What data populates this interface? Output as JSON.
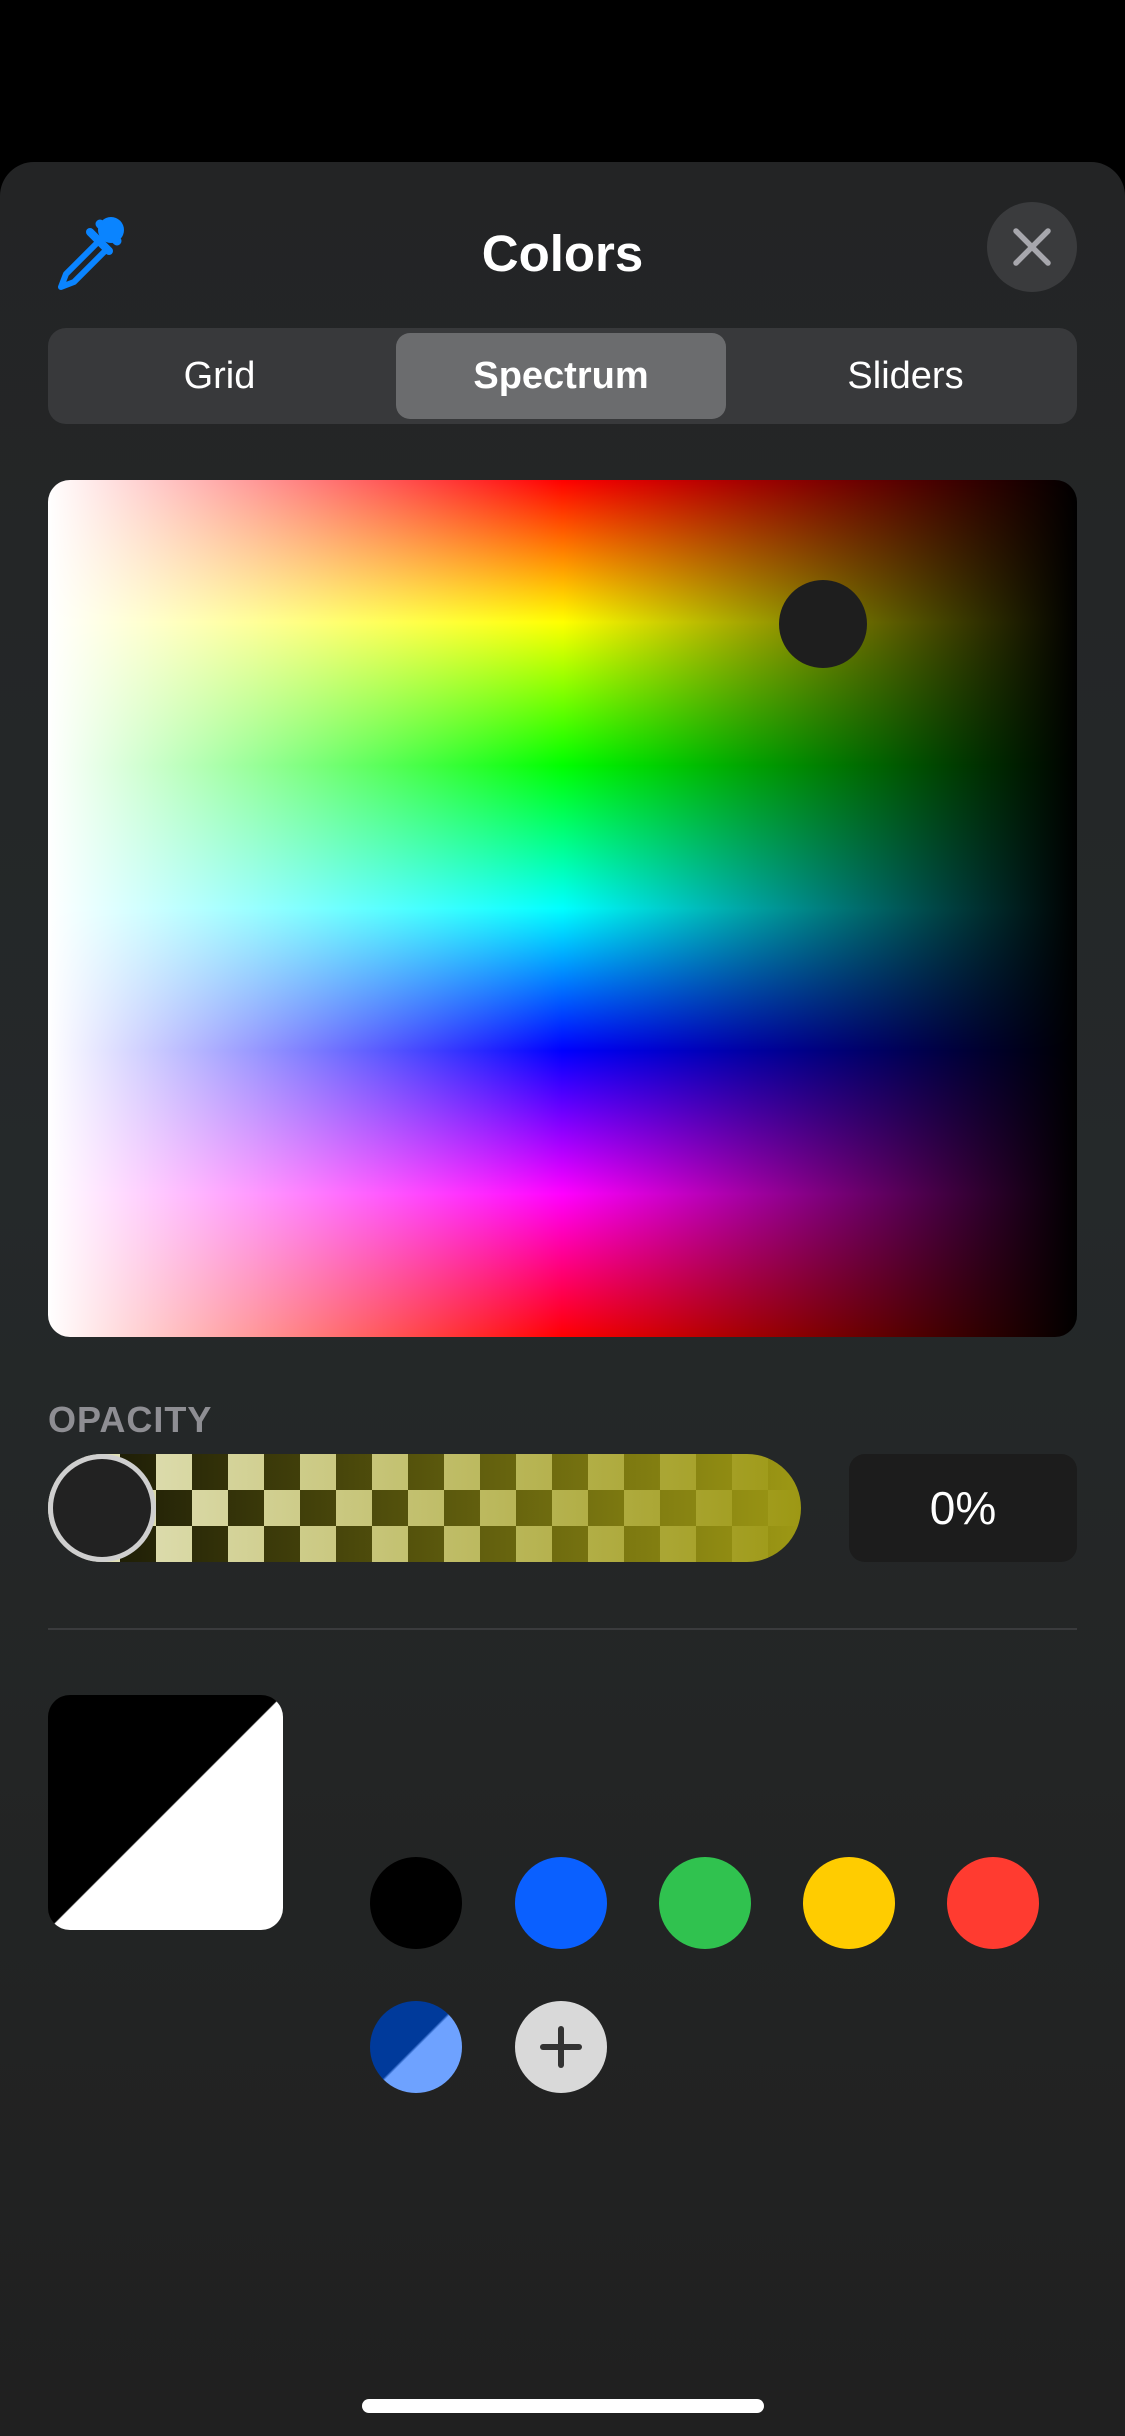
{
  "header": {
    "title": "Colors",
    "eyedropper_icon": "eyedropper-icon",
    "close_icon": "close-icon"
  },
  "tabs": [
    {
      "label": "Grid",
      "selected": false
    },
    {
      "label": "Spectrum",
      "selected": true
    },
    {
      "label": "Sliders",
      "selected": false
    }
  ],
  "opacity": {
    "label": "OPACITY",
    "value": "0%",
    "level": 0
  },
  "current_color": {
    "label": "current color swatch",
    "colors": [
      "#000000",
      "#ffffff"
    ]
  },
  "swatches": [
    {
      "color": "#000000"
    },
    {
      "color": "#0a60ff"
    },
    {
      "color": "#30c24f"
    },
    {
      "color": "#ffcc00"
    },
    {
      "color": "#ff3b30"
    },
    {
      "color": "#003a9b",
      "secondary_color": "#6ea2ff"
    }
  ],
  "add_swatch_icon": "plus-icon",
  "colors": {
    "accent": "#0a84ff",
    "sheet_background": "#232425",
    "selected_tab": "#6b6c6e"
  }
}
